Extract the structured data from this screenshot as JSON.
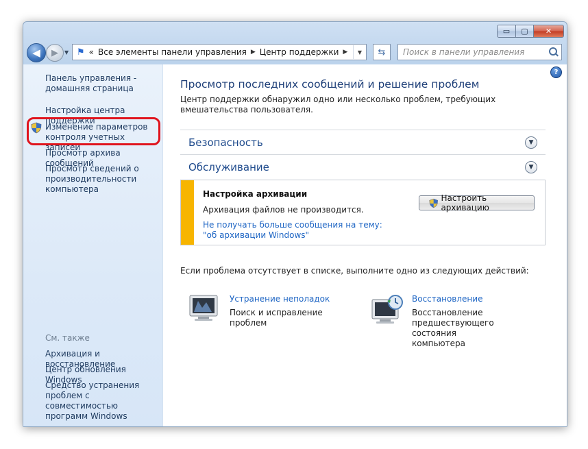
{
  "window": {
    "caption_buttons": {
      "minimize": "▭",
      "maximize": "▢",
      "close": "✕"
    }
  },
  "navbar": {
    "breadcrumb_overflow": "«",
    "breadcrumb": [
      "Все элементы панели управления",
      "Центр поддержки"
    ],
    "separator": "▶",
    "search_placeholder": "Поиск в панели управления"
  },
  "sidebar": {
    "home_link": "Панель управления - домашняя страница",
    "links": [
      "Настройка центра поддержки",
      "Изменение параметров контроля учетных записей",
      "Просмотр архива сообщений",
      "Просмотр сведений о производительности компьютера"
    ],
    "see_also_label": "См. также",
    "see_also": [
      "Архивация и восстановление",
      "Центр обновления Windows",
      "Средство устранения проблем с совместимостью программ Windows"
    ]
  },
  "main": {
    "title": "Просмотр последних сообщений и решение проблем",
    "intro": "Центр поддержки обнаружил одно или несколько проблем, требующих вмешательства пользователя.",
    "sections": [
      "Безопасность",
      "Обслуживание"
    ],
    "message": {
      "title": "Настройка архивации",
      "text": "Архивация файлов не производится.",
      "link": "Не получать больше сообщения на тему: \"об архивации Windows\"",
      "button": "Настроить архивацию",
      "accent_color": "#f7b500"
    },
    "bottom_text": "Если проблема отсутствует в списке, выполните одно из следующих действий:",
    "actions": [
      {
        "link": "Устранение неполадок",
        "description": "Поиск и исправление проблем",
        "icon": "troubleshoot-monitor-icon"
      },
      {
        "link": "Восстановление",
        "description": "Восстановление предшествующего состояния компьютера",
        "icon": "restore-monitor-clock-icon"
      }
    ]
  },
  "annotation": {
    "highlight_color": "#e0141d"
  }
}
